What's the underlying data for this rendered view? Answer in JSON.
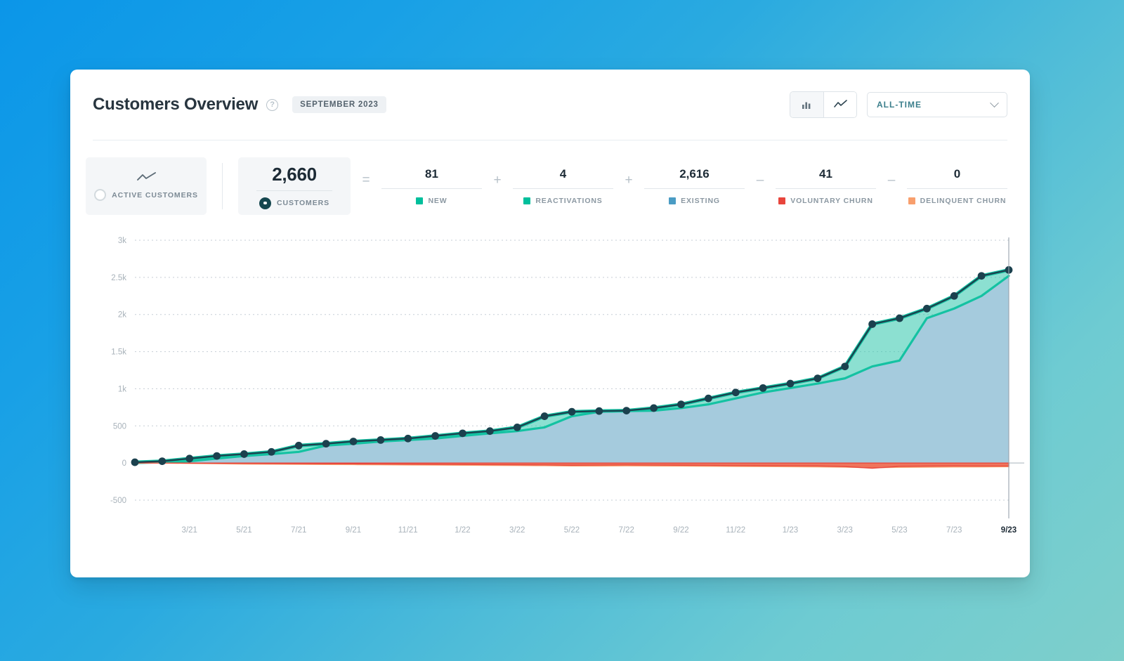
{
  "header": {
    "title": "Customers Overview",
    "help_icon": "question-mark-icon",
    "period_badge": "SEPTEMBER 2023",
    "bar_chart_icon": "bar-chart-icon",
    "line_chart_icon": "line-chart-icon",
    "range_label": "ALL-TIME",
    "chevron_icon": "chevron-down-icon"
  },
  "kpi": {
    "toggle": {
      "icon": "sparkline-icon",
      "label": "ACTIVE CUSTOMERS",
      "selected": false
    },
    "total": {
      "value": "2,660",
      "label": "CUSTOMERS",
      "selected": true
    },
    "equals": "=",
    "items": [
      {
        "op": "",
        "value": "81",
        "label": "NEW",
        "color": "#00bf9c"
      },
      {
        "op": "+",
        "value": "4",
        "label": "REACTIVATIONS",
        "color": "#00bf9c"
      },
      {
        "op": "+",
        "value": "2,616",
        "label": "EXISTING",
        "color": "#4a9cc4"
      },
      {
        "op": "–",
        "value": "41",
        "label": "VOLUNTARY CHURN",
        "color": "#e8453c"
      },
      {
        "op": "–",
        "value": "0",
        "label": "DELINQUENT CHURN",
        "color": "#f89f6d"
      }
    ]
  },
  "chart_data": {
    "type": "area",
    "title": "Customers Overview",
    "xlabel": "",
    "ylabel": "",
    "ylim": [
      -500,
      3000
    ],
    "yticks": [
      3000,
      2500,
      2000,
      1500,
      1000,
      500,
      0,
      -500
    ],
    "ytick_labels": [
      "3k",
      "2.5k",
      "2k",
      "1.5k",
      "1k",
      "500",
      "0",
      "-500"
    ],
    "grid": true,
    "legend_position": "top",
    "x_tick_labels": [
      "3/21",
      "5/21",
      "7/21",
      "9/21",
      "11/21",
      "1/22",
      "3/22",
      "5/22",
      "7/22",
      "9/22",
      "11/22",
      "1/23",
      "3/23",
      "5/23",
      "7/23",
      "9/23"
    ],
    "x_tick_highlight": "9/23",
    "x": [
      "1/21",
      "2/21",
      "3/21",
      "4/21",
      "5/21",
      "6/21",
      "7/21",
      "8/21",
      "9/21",
      "10/21",
      "11/21",
      "12/21",
      "1/22",
      "2/22",
      "3/22",
      "4/22",
      "5/22",
      "6/22",
      "7/22",
      "8/22",
      "9/22",
      "10/22",
      "11/22",
      "12/22",
      "1/23",
      "2/23",
      "3/23",
      "4/23",
      "5/23",
      "6/23",
      "7/23",
      "8/23",
      "9/23"
    ],
    "series": [
      {
        "name": "Customers",
        "color": "#1b414e",
        "type": "line-with-markers",
        "values": [
          10,
          24,
          60,
          95,
          120,
          150,
          235,
          260,
          290,
          310,
          330,
          365,
          400,
          430,
          480,
          630,
          690,
          700,
          705,
          740,
          790,
          870,
          950,
          1010,
          1070,
          1140,
          1300,
          1870,
          1950,
          2080,
          2250,
          2520,
          2600
        ]
      },
      {
        "name": "Existing",
        "color": "#a5cbdd",
        "type": "area",
        "values": [
          0,
          10,
          24,
          60,
          95,
          120,
          150,
          235,
          260,
          290,
          310,
          330,
          365,
          400,
          430,
          480,
          630,
          690,
          700,
          705,
          740,
          790,
          870,
          950,
          1010,
          1070,
          1140,
          1300,
          1380,
          1950,
          2080,
          2250,
          2520
        ]
      },
      {
        "name": "New",
        "color": "#2ec7ab",
        "type": "band",
        "values": [
          10,
          14,
          36,
          35,
          25,
          30,
          85,
          25,
          30,
          20,
          20,
          35,
          35,
          30,
          50,
          150,
          60,
          10,
          5,
          35,
          50,
          80,
          80,
          60,
          60,
          70,
          160,
          570,
          570,
          130,
          170,
          270,
          80
        ]
      },
      {
        "name": "Voluntary Churn",
        "color": "#e8453c",
        "type": "negative-band",
        "values": [
          0,
          0,
          -2,
          -4,
          -6,
          -8,
          -9,
          -10,
          -12,
          -14,
          -16,
          -18,
          -20,
          -22,
          -24,
          -26,
          -30,
          -28,
          -26,
          -28,
          -30,
          -32,
          -34,
          -36,
          -38,
          -40,
          -48,
          -70,
          -46,
          -42,
          -40,
          -41,
          -41
        ]
      },
      {
        "name": "Delinquent Churn",
        "color": "#f89f6d",
        "type": "negative-band",
        "values": [
          0,
          -2,
          -6,
          -10,
          -14,
          -16,
          -18,
          -20,
          -22,
          -24,
          -26,
          -28,
          -30,
          -32,
          -34,
          -36,
          -40,
          -40,
          -38,
          -40,
          -42,
          -44,
          -46,
          -48,
          -50,
          -52,
          -56,
          -64,
          -58,
          -56,
          -54,
          -52,
          -50
        ]
      }
    ]
  }
}
